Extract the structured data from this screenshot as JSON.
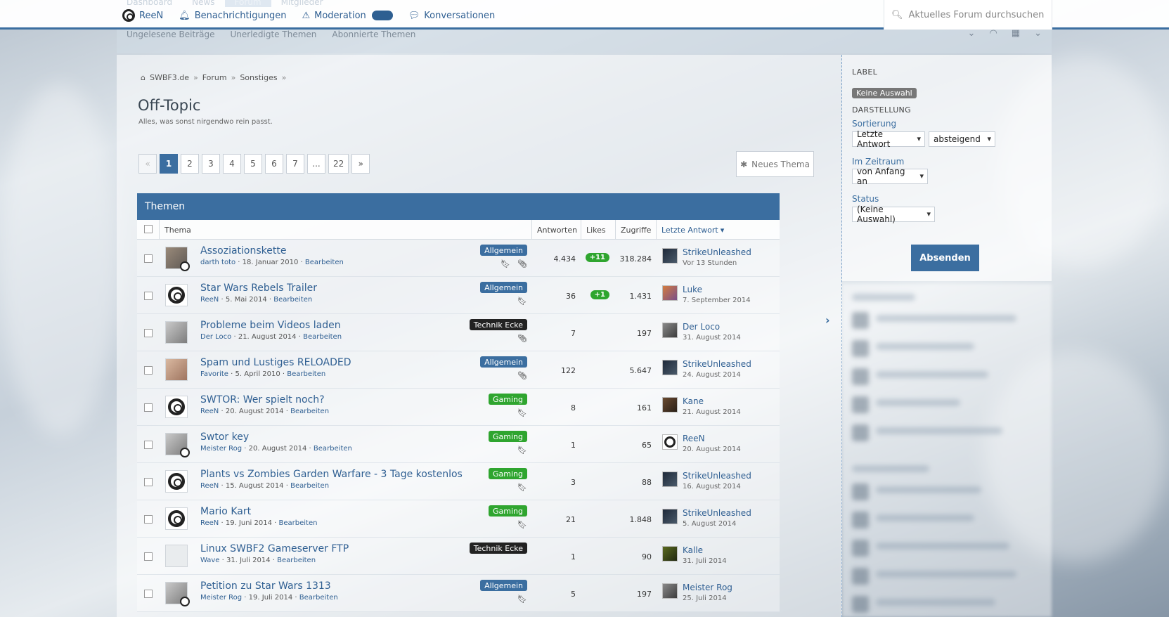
{
  "topbar": {
    "ghost_nav": [
      "Dashboard",
      "News",
      "Forum",
      "Mitglieder"
    ],
    "user_nav": [
      {
        "label": "ReeN",
        "icon": "portal-aperture-icon"
      },
      {
        "label": "Benachrichtigungen",
        "icon": "bell-icon"
      },
      {
        "label": "Moderation",
        "icon": "warning-icon"
      },
      {
        "label": "Konversationen",
        "icon": "chat-icon"
      }
    ],
    "search_placeholder": "Aktuelles Forum durchsuchen"
  },
  "subnav": {
    "links": [
      "Ungelesene Beiträge",
      "Unerledigte Themen",
      "Abonnierte Themen"
    ],
    "icons": [
      "chevron-down-icon",
      "rss-icon",
      "sitemap-icon",
      "chevron-down-icon"
    ]
  },
  "breadcrumb": [
    "SWBF3.de",
    "Forum",
    "Sonstiges"
  ],
  "page": {
    "title": "Off-Topic",
    "description": "Alles, was sonst nirgendwo rein passt."
  },
  "pagination": {
    "prev": "«",
    "pages": [
      "1",
      "2",
      "3",
      "4",
      "5",
      "6",
      "7",
      "...",
      "22"
    ],
    "next": "»",
    "current": "1"
  },
  "new_thread_label": "Neues Thema",
  "threads": {
    "header": "Themen",
    "columns": {
      "thema": "Thema",
      "antworten": "Antworten",
      "likes": "Likes",
      "zugriffe": "Zugriffe",
      "letzte_antwort": "Letzte Antwort"
    },
    "rows": [
      {
        "title": "Assoziationskette",
        "author": "darth toto",
        "date": "18. Januar 2010",
        "edit": "Bearbeiten",
        "prefix": "Allgemein",
        "prefix_color": "blue",
        "replies": "4.434",
        "likes": "+11",
        "views": "318.284",
        "last_user": "StrikeUnleashed",
        "last_time": "Vor 13 Stunden"
      },
      {
        "title": "Star Wars Rebels Trailer",
        "author": "ReeN",
        "date": "5. Mai 2014",
        "edit": "Bearbeiten",
        "prefix": "Allgemein",
        "prefix_color": "blue",
        "replies": "36",
        "likes": "+1",
        "views": "1.431",
        "last_user": "Luke",
        "last_time": "7. September 2014"
      },
      {
        "title": "Probleme beim Videos laden",
        "author": "Der Loco",
        "date": "21. August 2014",
        "edit": "Bearbeiten",
        "prefix": "Technik Ecke",
        "prefix_color": "black",
        "replies": "7",
        "likes": "",
        "views": "197",
        "last_user": "Der Loco",
        "last_time": "31. August 2014"
      },
      {
        "title": "Spam und Lustiges RELOADED",
        "author": "Favorite",
        "date": "5. April 2010",
        "edit": "Bearbeiten",
        "prefix": "Allgemein",
        "prefix_color": "blue",
        "replies": "122",
        "likes": "",
        "views": "5.647",
        "last_user": "StrikeUnleashed",
        "last_time": "24. August 2014"
      },
      {
        "title": "SWTOR: Wer spielt noch?",
        "author": "ReeN",
        "date": "20. August 2014",
        "edit": "Bearbeiten",
        "prefix": "Gaming",
        "prefix_color": "green",
        "replies": "8",
        "likes": "",
        "views": "161",
        "last_user": "Kane",
        "last_time": "21. August 2014"
      },
      {
        "title": "Swtor key",
        "author": "Meister Rog",
        "date": "20. August 2014",
        "edit": "Bearbeiten",
        "prefix": "Gaming",
        "prefix_color": "green",
        "replies": "1",
        "likes": "",
        "views": "65",
        "last_user": "ReeN",
        "last_time": "20. August 2014"
      },
      {
        "title": "Plants vs Zombies Garden Warfare - 3 Tage kostenlos",
        "author": "ReeN",
        "date": "15. August 2014",
        "edit": "Bearbeiten",
        "prefix": "Gaming",
        "prefix_color": "green",
        "replies": "3",
        "likes": "",
        "views": "88",
        "last_user": "StrikeUnleashed",
        "last_time": "16. August 2014"
      },
      {
        "title": "Mario Kart",
        "author": "ReeN",
        "date": "19. Juni 2014",
        "edit": "Bearbeiten",
        "prefix": "Gaming",
        "prefix_color": "green",
        "replies": "21",
        "likes": "",
        "views": "1.848",
        "last_user": "StrikeUnleashed",
        "last_time": "5. August 2014"
      },
      {
        "title": "Linux SWBF2 Gameserver FTP",
        "author": "Wave",
        "date": "31. Juli 2014",
        "edit": "Bearbeiten",
        "prefix": "Technik Ecke",
        "prefix_color": "black",
        "replies": "1",
        "likes": "",
        "views": "90",
        "last_user": "Kalle",
        "last_time": "31. Juli 2014"
      },
      {
        "title": "Petition zu Star Wars 1313",
        "author": "Meister Rog",
        "date": "19. Juli 2014",
        "edit": "Bearbeiten",
        "prefix": "Allgemein",
        "prefix_color": "blue",
        "replies": "5",
        "likes": "",
        "views": "197",
        "last_user": "Meister Rog",
        "last_time": "25. Juli 2014"
      }
    ]
  },
  "sidebar": {
    "label_heading": "LABEL",
    "label_chip": "Keine Auswahl",
    "display_heading": "DARSTELLUNG",
    "sort_label": "Sortierung",
    "sort_value": "Letzte Antwort",
    "order_value": "absteigend",
    "period_label": "Im Zeitraum",
    "period_value": "von Anfang an",
    "status_label": "Status",
    "status_value": "(Keine Auswahl)",
    "submit": "Absenden"
  },
  "colors": {
    "accent": "#3b6ea0",
    "link": "#2f5f92",
    "prefix_green": "#2fa52f",
    "prefix_black": "#222222"
  }
}
